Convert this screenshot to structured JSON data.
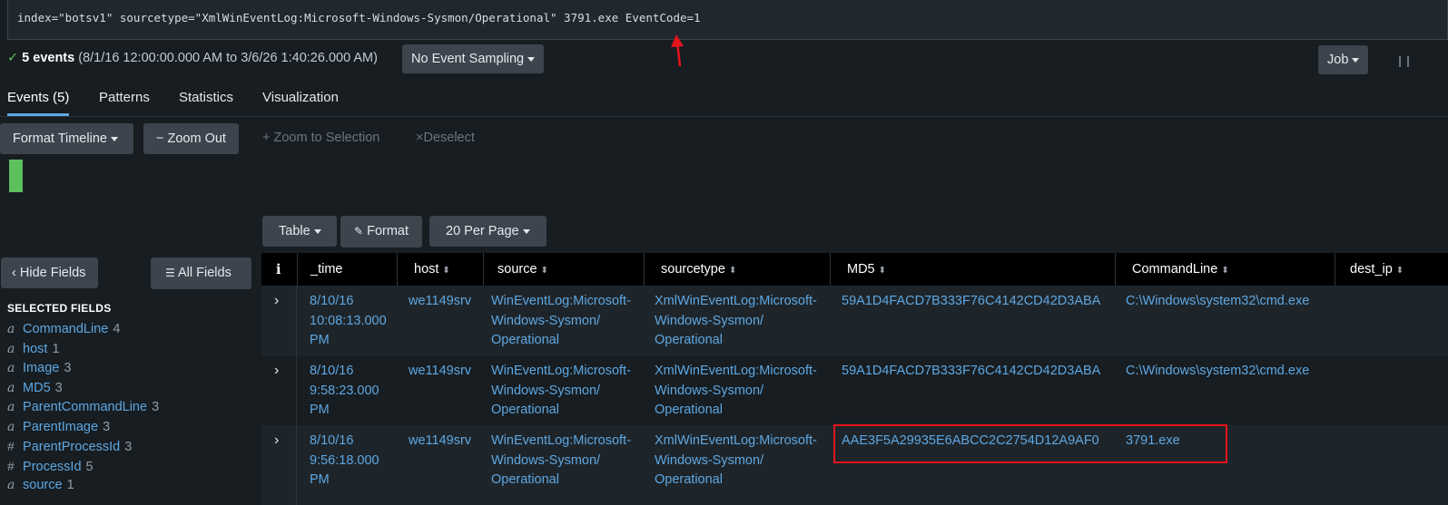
{
  "search": {
    "query": "index=\"botsv1\" sourcetype=\"XmlWinEventLog:Microsoft-Windows-Sysmon/Operational\" 3791.exe EventCode=1"
  },
  "status": {
    "check_icon": "checkmark-icon",
    "count": "5 events",
    "range": "(8/1/16 12:00:00.000 AM to 3/6/26 1:40:26.000 AM)",
    "sampling_label": "No Event Sampling",
    "job_label": "Job",
    "pause_icon": "pause-icon"
  },
  "tabs": [
    {
      "label": "Events (5)"
    },
    {
      "label": "Patterns"
    },
    {
      "label": "Statistics"
    },
    {
      "label": "Visualization"
    }
  ],
  "timeline": {
    "format_label": "Format Timeline",
    "zoom_out_label": "Zoom Out",
    "zoom_sel_label": "Zoom to Selection",
    "deselect_label": "Deselect",
    "bar_color": "#5cc05c"
  },
  "toolbar": {
    "table_label": "Table",
    "format_label": "Format",
    "per_page_label": "20 Per Page"
  },
  "sidebar": {
    "hide_fields": "Hide Fields",
    "all_fields": "All Fields",
    "selected_title": "SELECTED FIELDS",
    "fields": [
      {
        "type": "a",
        "name": "CommandLine",
        "count": "4"
      },
      {
        "type": "a",
        "name": "host",
        "count": "1"
      },
      {
        "type": "a",
        "name": "Image",
        "count": "3"
      },
      {
        "type": "a",
        "name": "MD5",
        "count": "3"
      },
      {
        "type": "a",
        "name": "ParentCommandLine",
        "count": "3"
      },
      {
        "type": "a",
        "name": "ParentImage",
        "count": "3"
      },
      {
        "type": "#",
        "name": "ParentProcessId",
        "count": "3"
      },
      {
        "type": "#",
        "name": "ProcessId",
        "count": "5"
      },
      {
        "type": "a",
        "name": "source",
        "count": "1"
      }
    ]
  },
  "table": {
    "info_icon": "i",
    "columns": [
      "_time",
      "host",
      "source",
      "sourcetype",
      "MD5",
      "CommandLine",
      "dest_ip"
    ],
    "rows": [
      {
        "time": "8/10/16\n10:08:13.000\nPM",
        "host": "we1149srv",
        "source": "WinEventLog:Microsoft-\nWindows-Sysmon/\nOperational",
        "sourcetype": "XmlWinEventLog:Microsoft-\nWindows-Sysmon/\nOperational",
        "md5": "59A1D4FACD7B333F76C4142CD42D3ABA",
        "cmd": "C:\\Windows\\system32\\cmd.exe"
      },
      {
        "time": "8/10/16\n9:58:23.000\nPM",
        "host": "we1149srv",
        "source": "WinEventLog:Microsoft-\nWindows-Sysmon/\nOperational",
        "sourcetype": "XmlWinEventLog:Microsoft-\nWindows-Sysmon/\nOperational",
        "md5": "59A1D4FACD7B333F76C4142CD42D3ABA",
        "cmd": "C:\\Windows\\system32\\cmd.exe"
      },
      {
        "time": "8/10/16\n9:56:18.000\nPM",
        "host": "we1149srv",
        "source": "WinEventLog:Microsoft-\nWindows-Sysmon/\nOperational",
        "sourcetype": "XmlWinEventLog:Microsoft-\nWindows-Sysmon/\nOperational",
        "md5": "AAE3F5A29935E6ABCC2C2754D12A9AF0",
        "cmd": "3791.exe"
      }
    ]
  },
  "annotations": {
    "arrow_color": "#e3141b",
    "box_color": "#e3141b"
  }
}
